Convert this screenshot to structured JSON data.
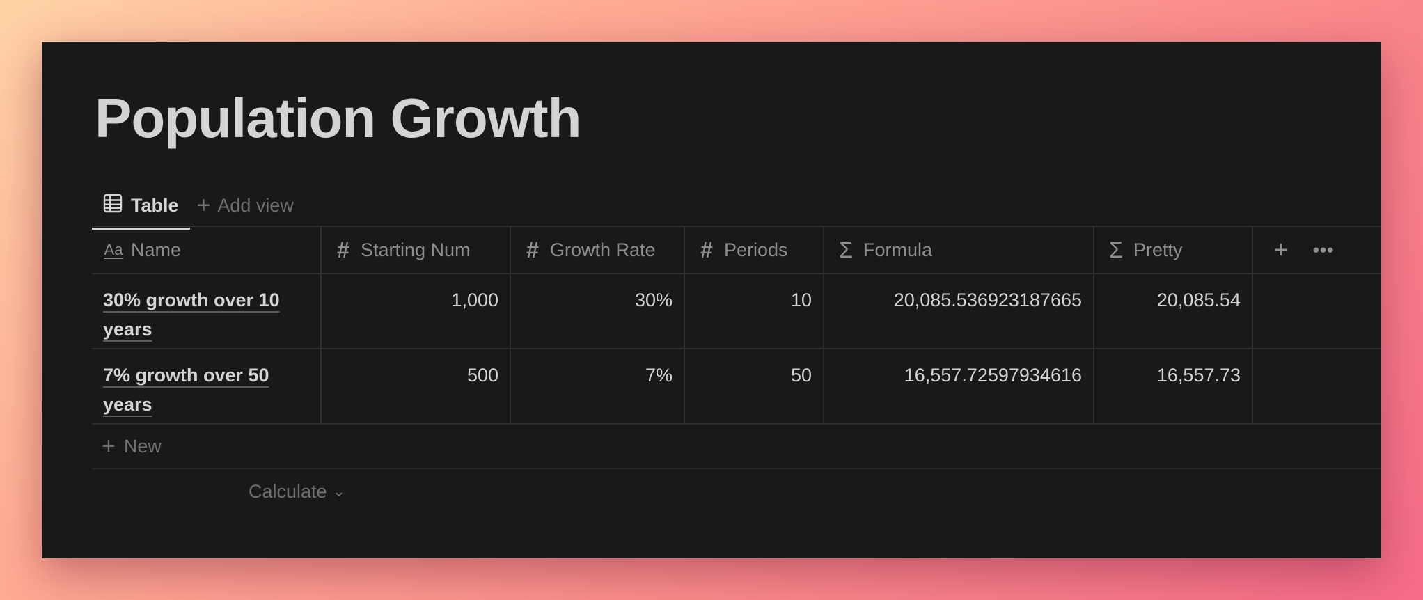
{
  "page": {
    "title": "Population Growth"
  },
  "views": {
    "active_label": "Table",
    "active_icon": "table-icon",
    "add_view_label": "Add view"
  },
  "table": {
    "columns": [
      {
        "label": "Name",
        "icon": "text-property-icon"
      },
      {
        "label": "Starting Num",
        "icon": "number-property-icon"
      },
      {
        "label": "Growth Rate",
        "icon": "number-property-icon"
      },
      {
        "label": "Periods",
        "icon": "number-property-icon"
      },
      {
        "label": "Formula",
        "icon": "formula-property-icon"
      },
      {
        "label": "Pretty",
        "icon": "formula-property-icon"
      }
    ],
    "rows": [
      {
        "name": "30% growth over 10 years",
        "starting_num": "1,000",
        "growth_rate": "30%",
        "periods": "10",
        "formula": "20,085.536923187665",
        "pretty": "20,085.54"
      },
      {
        "name": "7% growth over 50 years",
        "starting_num": "500",
        "growth_rate": "7%",
        "periods": "50",
        "formula": "16,557.72597934616",
        "pretty": "16,557.73"
      }
    ],
    "new_label": "New",
    "calculate_label": "Calculate"
  }
}
